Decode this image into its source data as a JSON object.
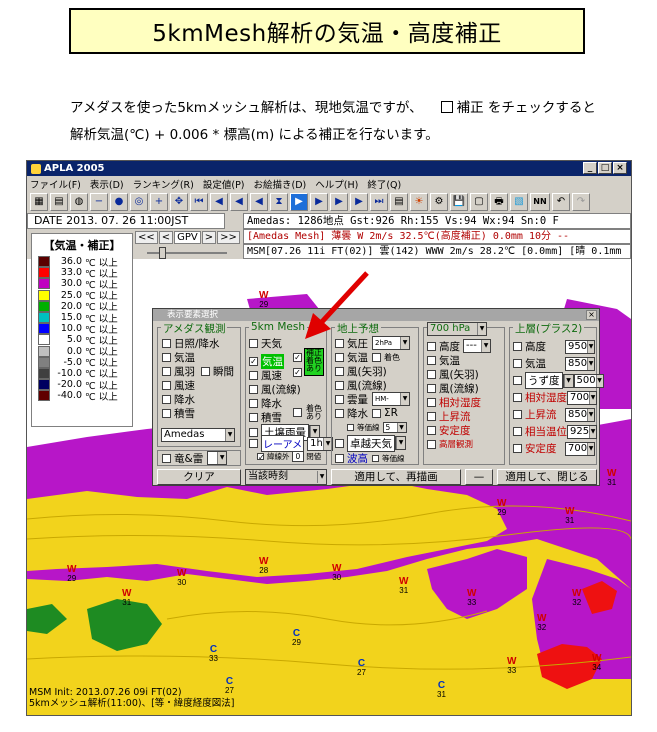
{
  "doc": {
    "title": "5kmMesh解析の気温・高度補正",
    "para1_a": "アメダスを使った5kmメッシュ解析は、現地気温ですが、",
    "para1_b": "補正  をチェックすると",
    "para2": "解析気温(℃)  +  0.006 * 標高(m)  による補正を行ないます。"
  },
  "window": {
    "title": "APLA 2005",
    "controls": [
      "_",
      "□",
      "×"
    ],
    "menu": [
      "ファイル(F)",
      "表示(D)",
      "ランキング(R)",
      "設定値(P)",
      "お絵描き(D)",
      "ヘルプ(H)",
      "終了(Q)"
    ],
    "toolbar": [
      "▦",
      "▤",
      "◍",
      "−",
      "●",
      "◎",
      "+",
      "✥",
      "⏮",
      "◀",
      "◀",
      "◀",
      "⧗",
      "▶",
      "▶",
      "▶",
      "▶",
      "⏭",
      "▤",
      "☀",
      "⚙",
      "💾",
      "▢",
      "🖶",
      "▧",
      "NN",
      "↶",
      "↷"
    ]
  },
  "header": {
    "date": "DATE 2013. 07. 26  11:00JST",
    "gpv_prev": "<<",
    "gpv_back": "<",
    "gpv_label": "GPV",
    "gpv_next": ">",
    "gpv_fwd": ">>",
    "row1": "Amedas: 1286地点  Gst:926 Rh:155 Vs:94 Wx:94 Sn:0 F",
    "row2": "[Amedas Mesh] 薄曇  W   2m/s  32.5℃(高度補正)  0.0mm  10分  --",
    "row3": "MSM[07.26 11i FT(02)] 雲(142) WWW 2m/s 28.2℃ [0.0mm] [晴 0.1mm"
  },
  "legend": {
    "title": "【気温・補正】",
    "unit": "℃ 以上",
    "items": [
      {
        "value": "36.0",
        "color": "#5a0000"
      },
      {
        "value": "33.0",
        "color": "#ff0000"
      },
      {
        "value": "30.0",
        "color": "#c000c0"
      },
      {
        "value": "25.0",
        "color": "#ffff00"
      },
      {
        "value": "20.0",
        "color": "#00b000"
      },
      {
        "value": "15.0",
        "color": "#00c0c0"
      },
      {
        "value": "10.0",
        "color": "#0000ff"
      },
      {
        "value": "5.0",
        "color": "#ffffff"
      },
      {
        "value": "0.0",
        "color": "#c0c0c0"
      },
      {
        "value": "-5.0",
        "color": "#808080"
      },
      {
        "value": "-10.0",
        "color": "#404040"
      },
      {
        "value": "-20.0",
        "color": "#000060"
      },
      {
        "value": "-40.0",
        "color": "#600000"
      }
    ]
  },
  "map_labels": [
    {
      "w": "W",
      "n": "29"
    },
    {
      "w": "W",
      "n": "28"
    },
    {
      "w": "W",
      "n": "30"
    },
    {
      "w": "W",
      "n": "31"
    },
    {
      "w": "W",
      "n": "33"
    },
    {
      "w": "W",
      "n": "32"
    },
    {
      "w": "W",
      "n": "30"
    },
    {
      "w": "W",
      "n": "29"
    },
    {
      "w": "W",
      "n": "31"
    },
    {
      "w": "W",
      "n": "32"
    },
    {
      "w": "C",
      "n": "29"
    },
    {
      "w": "C",
      "n": "27"
    },
    {
      "w": "W",
      "n": "31"
    },
    {
      "w": "C",
      "n": "31"
    },
    {
      "w": "C",
      "n": "27"
    },
    {
      "w": "W",
      "n": "33"
    },
    {
      "w": "W",
      "n": "34"
    },
    {
      "w": "W",
      "n": "31"
    },
    {
      "w": "W",
      "n": "29"
    },
    {
      "w": "C",
      "n": "33"
    }
  ],
  "status": {
    "line1": "MSM Init: 2013.07.26 09i FT(02)",
    "line2": "5kmメッシュ解析(11:00)、[等・緯度経度図法]"
  },
  "dialog": {
    "title": "表示要素選択",
    "close": "×",
    "amedas": {
      "title": "アメダス観測",
      "items": [
        "日照/降水",
        "気温",
        "風羽",
        "風速",
        "降水",
        "積雪"
      ],
      "extra": "瞬間",
      "select": "Amedas",
      "thunder": "竜&雷"
    },
    "mesh": {
      "title": "5km Mesh",
      "items": [
        "天気",
        "気温",
        "風速",
        "風(流線)",
        "降水",
        "積雪",
        "土壌雨量"
      ],
      "mesh_check_checked": "✓",
      "hosei_lines": [
        "補正",
        "着色",
        "あり"
      ],
      "chaku_lines": [
        "着色",
        "あり"
      ],
      "chaku2_lines": [
        "着色",
        "あり"
      ],
      "rader": "レーアメ",
      "rader_sel": "1h",
      "lat_note": "緯線外",
      "lat_val": "0",
      "lat_end": "閉値"
    },
    "ground": {
      "title": "地上予想",
      "items": [
        "気圧",
        "気温",
        "風(矢羽)",
        "風(流線)",
        "雲量",
        "降水"
      ],
      "kiatsu_sel": "2hPa",
      "kion_extra": "着色",
      "unryo_sel": "HM-",
      "kousui_extra": "ΣR",
      "tohen": "等価線",
      "tohen_val": "5",
      "takuetsu": "卓越天気",
      "hakou": "波高",
      "hakou_extra": "等価線"
    },
    "hpa": {
      "select": "700 hPa",
      "items": [
        "高度",
        "気温",
        "風(矢羽)",
        "風(流線)",
        "相対湿度",
        "上昇流",
        "安定度",
        "高層観測"
      ],
      "kodo_sel": "---"
    },
    "upper": {
      "title": "上層(プラス2)",
      "items": [
        "高度",
        "気温",
        "うず度",
        "相対湿度",
        "上昇流",
        "相当温位",
        "安定度"
      ],
      "values": [
        "950",
        "850",
        "500",
        "700",
        "850",
        "925",
        "700"
      ]
    },
    "buttons": {
      "clear": "クリア",
      "time": "当該時刻",
      "apply": "適用して、再描画",
      "dash": "—",
      "apply_close": "適用して、閉じる"
    }
  }
}
